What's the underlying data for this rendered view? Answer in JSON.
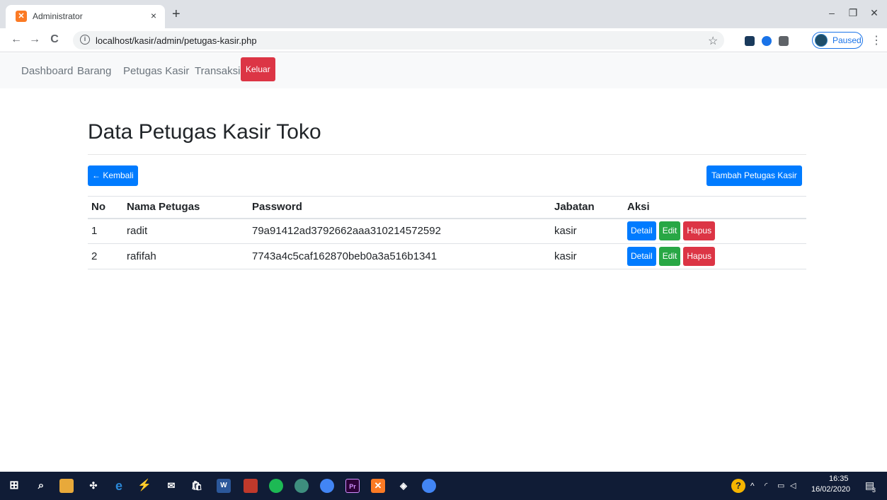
{
  "browser": {
    "tab_title": "Administrator",
    "tab_close": "×",
    "new_tab": "+",
    "url": "localhost/kasir/admin/petugas-kasir.php",
    "profile_label": "Paused",
    "minimize": "–",
    "restore": "❐",
    "close": "✕",
    "back": "←",
    "forward": "→",
    "reload": "C",
    "info": "i",
    "star": "☆",
    "menu": "⋮"
  },
  "nav": {
    "links": [
      "Dashboard",
      "Barang",
      "Petugas Kasir",
      "Transaksi"
    ],
    "logout": "Keluar"
  },
  "page": {
    "title": "Data Petugas Kasir Toko",
    "back_button": "← Kembali",
    "add_button": "Tambah Petugas Kasir"
  },
  "table": {
    "headers": [
      "No",
      "Nama Petugas",
      "Password",
      "Jabatan",
      "Aksi"
    ],
    "rows": [
      {
        "no": "1",
        "nama": "radit",
        "password": "79a91412ad3792662aaa310214572592",
        "jabatan": "kasir"
      },
      {
        "no": "2",
        "nama": "rafifah",
        "password": "7743a4c5caf162870beb0a3a516b1341",
        "jabatan": "kasir"
      }
    ],
    "action_labels": {
      "detail": "Detail",
      "edit": "Edit",
      "delete": "Hapus"
    }
  },
  "taskbar": {
    "time": "16:35",
    "date": "16/02/2020",
    "notification_count": "3"
  },
  "colors": {
    "primary": "#007bff",
    "success": "#28a745",
    "danger": "#dc3545",
    "nav_bg": "#f8f9fa",
    "taskbar_bg": "#101c36"
  }
}
